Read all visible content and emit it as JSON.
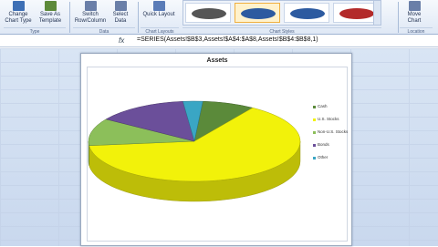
{
  "ribbon": {
    "buttons": [
      {
        "label": "Change Chart Type",
        "icon": "chart-type-icon",
        "color": "#3d6fb5"
      },
      {
        "label": "Save As Template",
        "icon": "template-icon",
        "color": "#5d8a3a"
      },
      {
        "label": "Switch Row/Column",
        "icon": "switch-icon",
        "color": "#6a7fa8"
      },
      {
        "label": "Select Data",
        "icon": "select-data-icon",
        "color": "#6a7fa8"
      },
      {
        "label": "Quick Layout",
        "icon": "layout-icon",
        "color": "#5a7cb8"
      },
      {
        "label": "Move Chart",
        "icon": "move-chart-icon",
        "color": "#6a7fa8"
      }
    ],
    "groups": [
      "Type",
      "Data",
      "Chart Layouts",
      "Chart Styles",
      "Location"
    ],
    "gallery_colors": [
      "#555555",
      "#2c5aa0",
      "#2c5aa0",
      "#b32a2a"
    ]
  },
  "formula": {
    "text": "=SERIES(Assets!$B$3,Assets!$A$4:$A$8,Assets!$B$4:$B$8,1)"
  },
  "chart_data": {
    "type": "pie",
    "title": "Assets",
    "categories": [
      "Cash",
      "U.S. Stocks",
      "Non-U.S. Stocks",
      "Bonds",
      "Other"
    ],
    "values": [
      8,
      64,
      11,
      14,
      3
    ],
    "colors": [
      "#5b8a3a",
      "#f2f20a",
      "#8cbf5a",
      "#6b4f9a",
      "#3aa6c4"
    ],
    "legend_position": "right"
  }
}
